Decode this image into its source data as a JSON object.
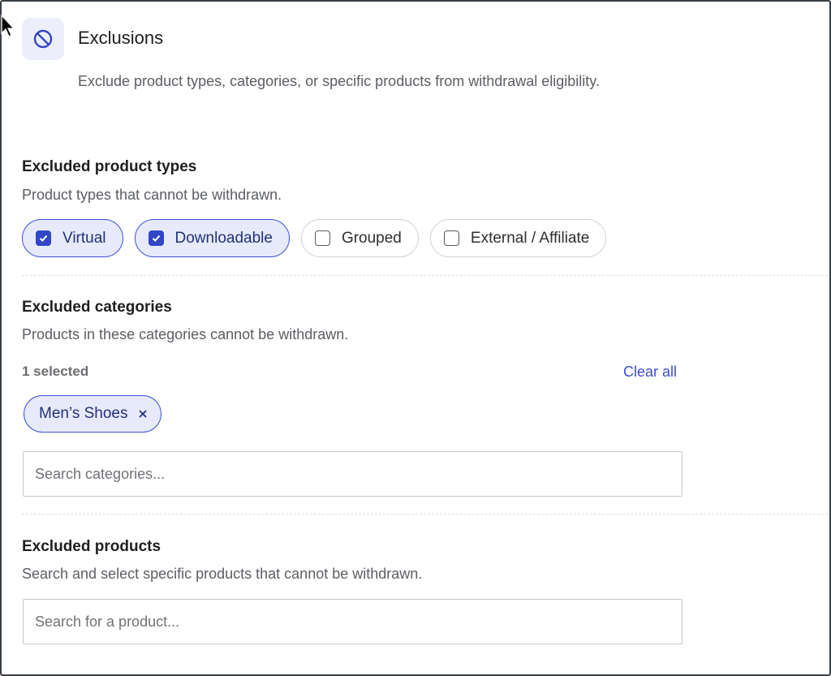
{
  "header": {
    "icon": "block-icon",
    "title": "Exclusions",
    "description": "Exclude product types, categories, or specific products from withdrawal eligibility."
  },
  "product_types": {
    "title": "Excluded product types",
    "description": "Product types that cannot be withdrawn.",
    "options": [
      {
        "label": "Virtual",
        "checked": true
      },
      {
        "label": "Downloadable",
        "checked": true
      },
      {
        "label": "Grouped",
        "checked": false
      },
      {
        "label": "External / Affiliate",
        "checked": false
      }
    ]
  },
  "categories": {
    "title": "Excluded categories",
    "description": "Products in these categories cannot be withdrawn.",
    "selected_count": "1 selected",
    "clear_label": "Clear all",
    "tags": [
      "Men’s Shoes"
    ],
    "search_placeholder": "Search categories..."
  },
  "products": {
    "title": "Excluded products",
    "description": "Search and select specific products that cannot be withdrawn.",
    "search_placeholder": "Search for a product..."
  },
  "colors": {
    "accent": "#3246c8",
    "accent_bg": "#e6eafb"
  }
}
